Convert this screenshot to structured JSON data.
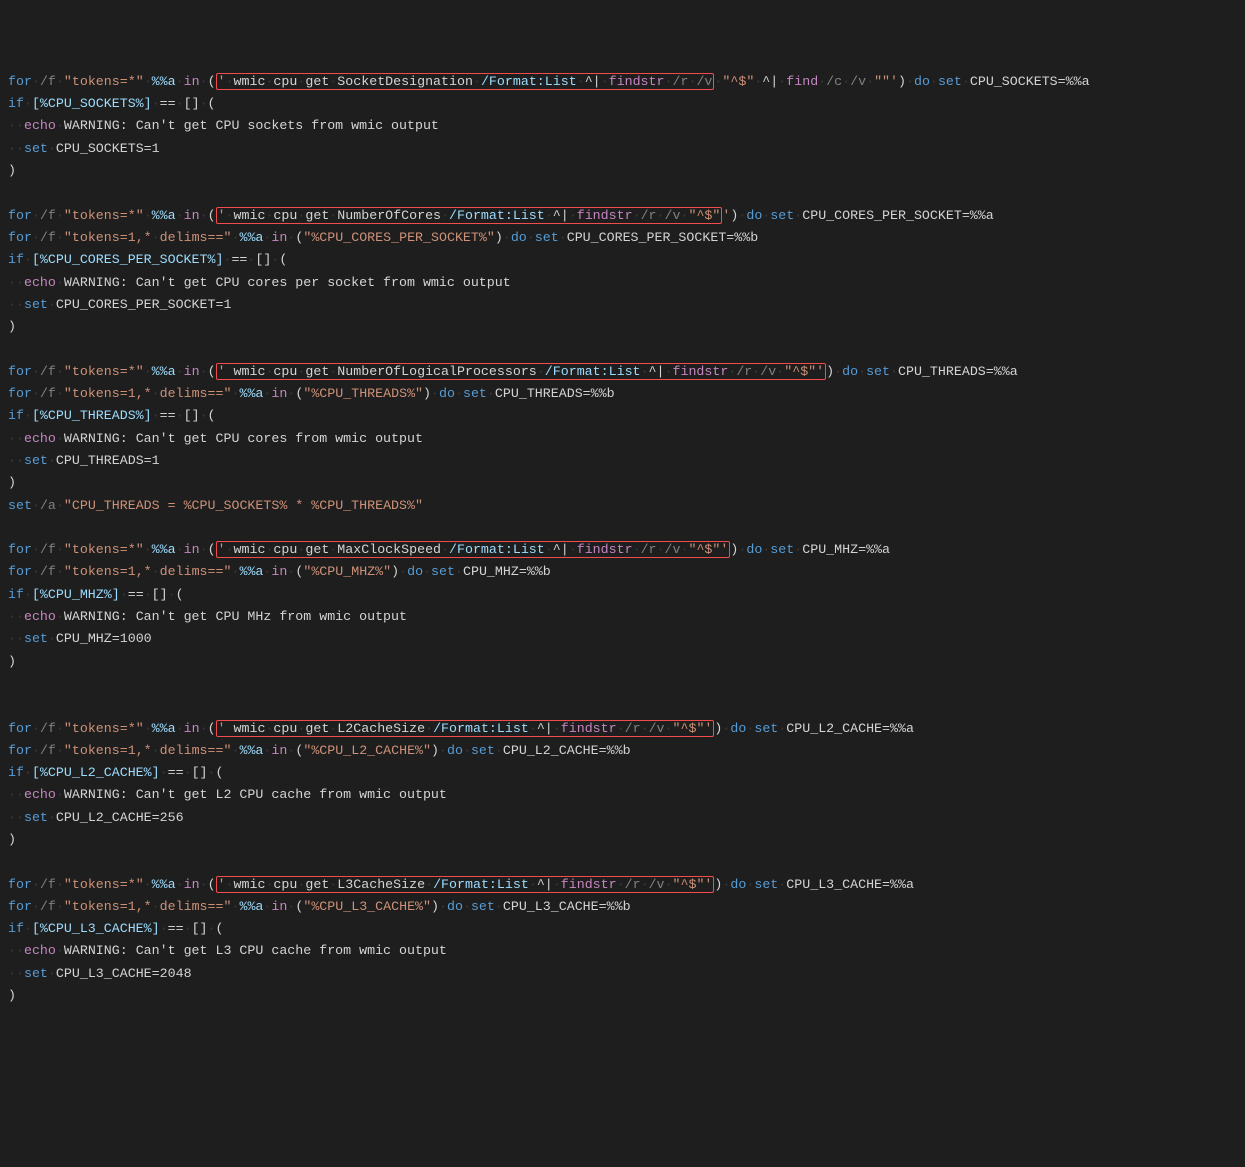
{
  "ws": "·",
  "tok": {
    "for": "for",
    "set": "set",
    "if": "if",
    "do": "do",
    "echo": "echo",
    "findstr": "findstr",
    "find": "find",
    "in": "in"
  },
  "flags": {
    "f": "/f",
    "tokens_star": "\"tokens=*\"",
    "tokens1_delims": "\"tokens=1,*",
    "delims": "delims==\"",
    "r": "/r",
    "v": "/v",
    "c": "/c",
    "a": "/a",
    "format_list": "/Format:List"
  },
  "pct": {
    "a": "%%a",
    "b": "%%b"
  },
  "blocks": [
    {
      "wmic_parts": [
        "'",
        "wmic",
        "cpu",
        "get",
        "SocketDesignation",
        "/Format:List",
        "^|",
        "findstr",
        "/r",
        "/v"
      ],
      "wmic_tail": [
        "\"^$\"",
        "^|",
        "find",
        "/c",
        "/v",
        "\"\"'"
      ],
      "set_var": "CPU_SOCKETS=%%a",
      "if_var": "[%CPU_SOCKETS%]",
      "if_cmp": "[]",
      "warn": "WARNING: Can't get CPU sockets from wmic output",
      "fallback_set": "CPU_SOCKETS=1",
      "has_second_for": false,
      "box_end": 10
    },
    {
      "wmic_parts": [
        "'",
        "wmic",
        "cpu",
        "get",
        "NumberOfCores",
        "/Format:List",
        "^|",
        "findstr",
        "/r",
        "/v",
        "\"^$\""
      ],
      "wmic_tail": [
        "'"
      ],
      "set_var": "CPU_CORES_PER_SOCKET=%%a",
      "if_var": "[%CPU_CORES_PER_SOCKET%]",
      "if_cmp": "[]",
      "warn": "WARNING: Can't get CPU cores per socket from wmic output",
      "fallback_set": "CPU_CORES_PER_SOCKET=1",
      "has_second_for": true,
      "second_var": "\"%CPU_CORES_PER_SOCKET%\"",
      "second_set": "CPU_CORES_PER_SOCKET=%%b",
      "box_end": 11
    },
    {
      "wmic_parts": [
        "'",
        "wmic",
        "cpu",
        "get",
        "NumberOfLogicalProcessors",
        "/Format:List",
        "^|",
        "findstr",
        "/r",
        "/v",
        "\"^$\"'"
      ],
      "wmic_tail": [],
      "set_var": "CPU_THREADS=%%a",
      "if_var": "[%CPU_THREADS%]",
      "if_cmp": "[]",
      "warn": "WARNING: Can't get CPU cores from wmic output",
      "fallback_set": "CPU_THREADS=1",
      "has_second_for": true,
      "second_var": "\"%CPU_THREADS%\"",
      "second_set": "CPU_THREADS=%%b",
      "box_end": 11,
      "leading_space": true,
      "extra_after": {
        "set_a_str": "\"CPU_THREADS = %CPU_SOCKETS% * %CPU_THREADS%\""
      }
    },
    {
      "wmic_parts": [
        "'",
        "wmic",
        "cpu",
        "get",
        "MaxClockSpeed",
        "/Format:List",
        "^|",
        "findstr",
        "/r",
        "/v",
        "\"^$\"'"
      ],
      "wmic_tail": [],
      "set_var": "CPU_MHZ=%%a",
      "if_var": "[%CPU_MHZ%]",
      "if_cmp": "[]",
      "warn": "WARNING: Can't get CPU MHz from wmic output",
      "fallback_set": "CPU_MHZ=1000",
      "has_second_for": true,
      "second_var": "\"%CPU_MHZ%\"",
      "second_set": "CPU_MHZ=%%b",
      "box_end": 11
    },
    {
      "wmic_parts": [
        "'",
        "wmic",
        "cpu",
        "get",
        "L2CacheSize",
        "/Format:List",
        "^|",
        "findstr",
        "/r",
        "/v",
        "\"^$\"'"
      ],
      "wmic_tail": [],
      "set_var": "CPU_L2_CACHE=%%a",
      "if_var": "[%CPU_L2_CACHE%]",
      "if_cmp": "[]",
      "warn": "WARNING: Can't get L2 CPU cache from wmic output",
      "fallback_set": "CPU_L2_CACHE=256",
      "has_second_for": true,
      "second_var": "\"%CPU_L2_CACHE%\"",
      "second_set": "CPU_L2_CACHE=%%b",
      "box_end": 11,
      "leading_space": true
    },
    {
      "wmic_parts": [
        "'",
        "wmic",
        "cpu",
        "get",
        "L3CacheSize",
        "/Format:List",
        "^|",
        "findstr",
        "/r",
        "/v",
        "\"^$\"'"
      ],
      "wmic_tail": [],
      "set_var": "CPU_L3_CACHE=%%a",
      "if_var": "[%CPU_L3_CACHE%]",
      "if_cmp": "[]",
      "warn": "WARNING: Can't get L3 CPU cache from wmic output",
      "fallback_set": "CPU_L3_CACHE=2048",
      "has_second_for": true,
      "second_var": "\"%CPU_L3_CACHE%\"",
      "second_set": "CPU_L3_CACHE=%%b",
      "box_end": 11
    }
  ]
}
